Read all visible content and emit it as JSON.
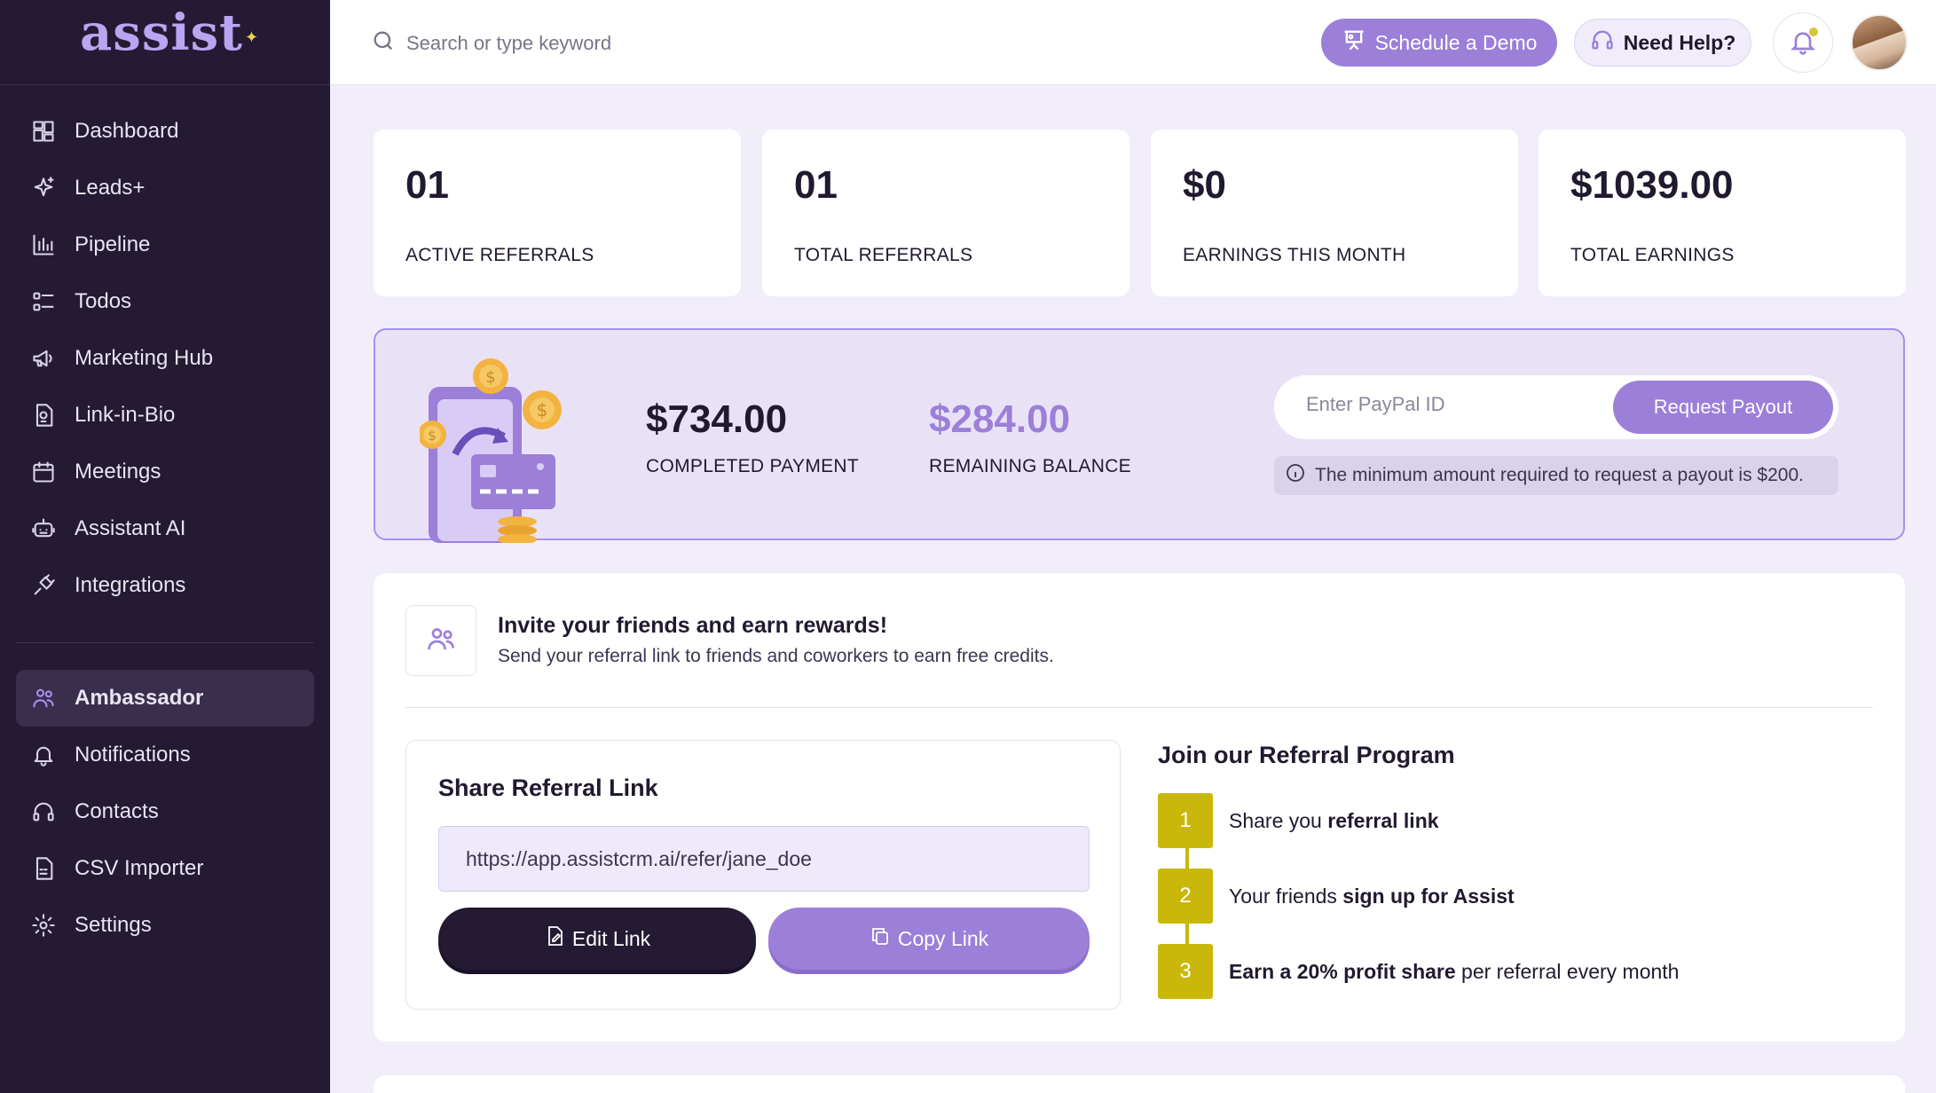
{
  "brand": {
    "logo_text": "assist",
    "accent": "#9b7fd8",
    "sidebar_bg": "#241a33",
    "step_color": "#c9b80a"
  },
  "sidebar": {
    "items": [
      {
        "label": "Dashboard",
        "icon": "dashboard-icon"
      },
      {
        "label": "Leads+",
        "icon": "sparkle-icon"
      },
      {
        "label": "Pipeline",
        "icon": "bar-chart-icon"
      },
      {
        "label": "Todos",
        "icon": "checklist-icon"
      },
      {
        "label": "Marketing Hub",
        "icon": "megaphone-icon"
      },
      {
        "label": "Link-in-Bio",
        "icon": "link-doc-icon"
      },
      {
        "label": "Meetings",
        "icon": "calendar-icon"
      },
      {
        "label": "Assistant AI",
        "icon": "robot-icon"
      },
      {
        "label": "Integrations",
        "icon": "plug-icon"
      }
    ],
    "secondary": [
      {
        "label": "Ambassador",
        "icon": "users-icon",
        "active": true
      },
      {
        "label": "Notifications",
        "icon": "bell-icon"
      },
      {
        "label": "Contacts",
        "icon": "headset-icon"
      },
      {
        "label": "CSV Importer",
        "icon": "csv-file-icon"
      },
      {
        "label": "Settings",
        "icon": "gear-icon"
      }
    ]
  },
  "topbar": {
    "search_placeholder": "Search or type keyword",
    "demo_label": "Schedule a Demo",
    "help_label": "Need Help?"
  },
  "stats": [
    {
      "value": "01",
      "label": "ACTIVE REFERRALS"
    },
    {
      "value": "01",
      "label": "TOTAL REFERRALS"
    },
    {
      "value": "$0",
      "label": "EARNINGS THIS MONTH"
    },
    {
      "value": "$1039.00",
      "label": "TOTAL EARNINGS"
    }
  ],
  "payout": {
    "completed_amount": "$734.00",
    "completed_label": "COMPLETED PAYMENT",
    "remaining_amount": "$284.00",
    "remaining_label": "REMAINING BALANCE",
    "paypal_placeholder": "Enter PayPal ID",
    "request_label": "Request Payout",
    "min_note": "The minimum amount required to request a payout is $200."
  },
  "referral": {
    "invite_title": "Invite your friends and earn rewards!",
    "invite_sub": "Send your referral link to friends and coworkers to earn free credits.",
    "share_title": "Share Referral Link",
    "link": "https://app.assistcrm.ai/refer/jane_doe",
    "edit_label": "Edit Link",
    "copy_label": "Copy Link",
    "join_title": "Join our Referral Program",
    "steps": [
      {
        "num": "1",
        "pre": "Share you ",
        "bold": "referral link",
        "post": ""
      },
      {
        "num": "2",
        "pre": "Your friends ",
        "bold": "sign up for Assist",
        "post": ""
      },
      {
        "num": "3",
        "pre": "",
        "bold": "Earn a 20% profit share",
        "post": " per referral every month"
      }
    ]
  }
}
